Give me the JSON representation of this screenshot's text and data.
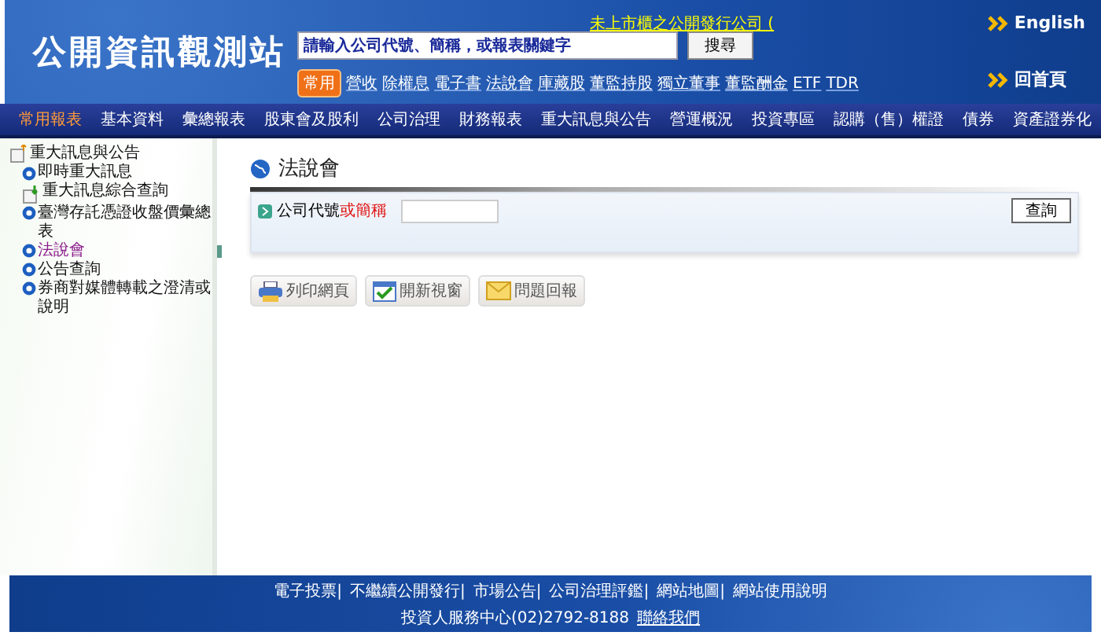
{
  "header": {
    "logo": "公開資訊觀測站",
    "search": {
      "placeholder": "請輸入公司代號、簡稱，或報表關鍵字",
      "button": "搜尋"
    },
    "notice_link": "未上市櫃之公開發行公司 (",
    "quick_label": "常用",
    "quick_links": [
      "營收",
      "除權息",
      "電子書",
      "法說會",
      "庫藏股",
      "董監持股",
      "獨立董事",
      "董監酬金",
      "ETF",
      "TDR"
    ],
    "english": "English",
    "home": "回首頁"
  },
  "nav": [
    {
      "label": "常用報表",
      "selected": true
    },
    {
      "label": "基本資料",
      "selected": false
    },
    {
      "label": "彙總報表",
      "selected": false
    },
    {
      "label": "股東會及股利",
      "selected": false
    },
    {
      "label": "公司治理",
      "selected": false
    },
    {
      "label": "財務報表",
      "selected": false
    },
    {
      "label": "重大訊息與公告",
      "selected": false
    },
    {
      "label": "營運概況",
      "selected": false
    },
    {
      "label": "投資專區",
      "selected": false
    },
    {
      "label": "認購（售）權證",
      "selected": false
    },
    {
      "label": "債券",
      "selected": false
    },
    {
      "label": "資產證券化",
      "selected": false
    }
  ],
  "sidebar": {
    "title": "重大訊息與公告",
    "children": [
      {
        "label": "即時重大訊息",
        "kind": "bullet",
        "selected": false
      },
      {
        "label": "重大訊息綜合查詢",
        "kind": "doc",
        "selected": false
      },
      {
        "label": "臺灣存託憑證收盤價彙總表",
        "kind": "bullet",
        "selected": false
      },
      {
        "label": "法說會",
        "kind": "bullet",
        "selected": true
      },
      {
        "label": "公告查詢",
        "kind": "bullet",
        "selected": false
      },
      {
        "label": "券商對媒體轉載之澄清或說明",
        "kind": "bullet",
        "selected": false
      }
    ]
  },
  "main": {
    "title": "法說會",
    "form": {
      "label": "公司代號",
      "label_hint": "或簡稱",
      "button": "查詢"
    },
    "actions": [
      {
        "label": "列印網頁",
        "kind": "print"
      },
      {
        "label": "開新視窗",
        "kind": "window"
      },
      {
        "label": "問題回報",
        "kind": "mail"
      }
    ]
  },
  "footer": {
    "links": [
      "電子投票|",
      "不繼續公開發行|",
      "市場公告|",
      "公司治理評鑑|",
      "網站地圖|",
      "網站使用說明"
    ],
    "service": "投資人服務中心(02)2792-8188",
    "contact": "聯絡我們"
  }
}
